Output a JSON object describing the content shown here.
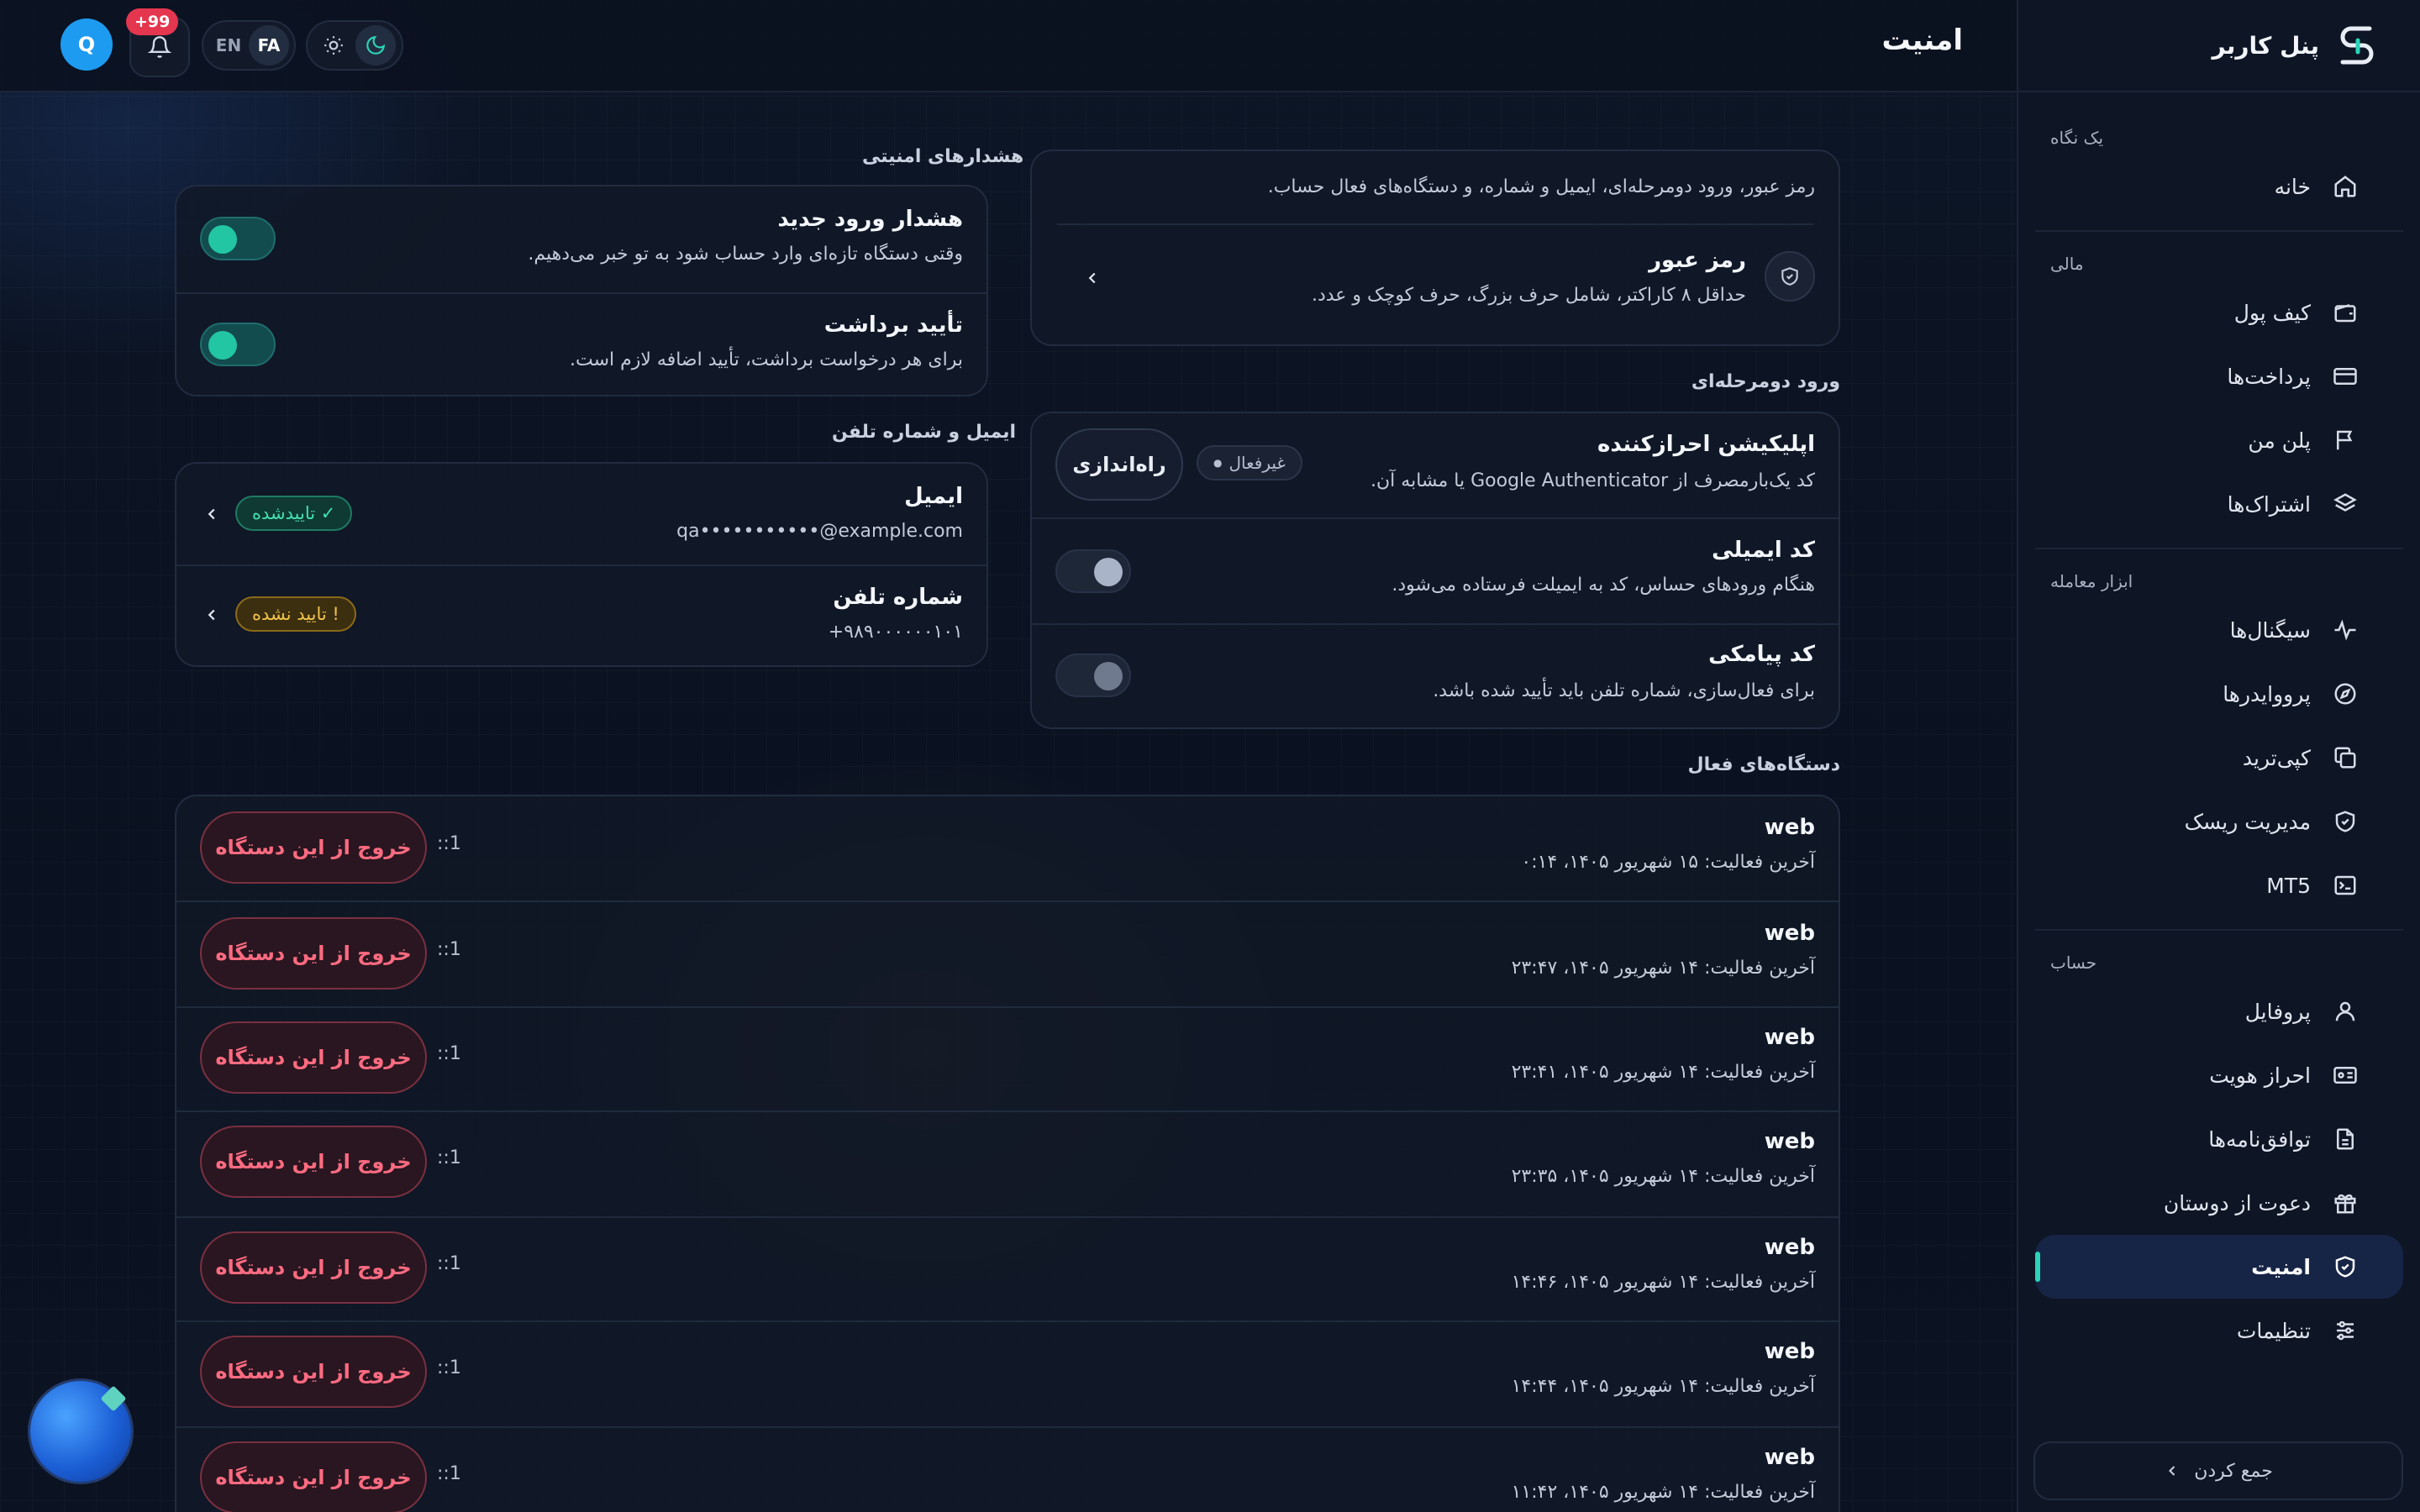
{
  "sidebar": {
    "brand": "پنل کاربر",
    "sections": [
      {
        "label": "یک نگاه",
        "items": [
          {
            "label": "خانه",
            "icon": "home-icon"
          }
        ]
      },
      {
        "label": "مالی",
        "items": [
          {
            "label": "کیف پول",
            "icon": "wallet-icon"
          },
          {
            "label": "پرداخت‌ها",
            "icon": "card-icon"
          },
          {
            "label": "پلن من",
            "icon": "flag-icon"
          },
          {
            "label": "اشتراک‌ها",
            "icon": "layers-icon"
          }
        ]
      },
      {
        "label": "ابزار معامله",
        "items": [
          {
            "label": "سیگنال‌ها",
            "icon": "pulse-icon"
          },
          {
            "label": "پرووایدرها",
            "icon": "compass-icon"
          },
          {
            "label": "کپی‌ترید",
            "icon": "copy-icon"
          },
          {
            "label": "مدیریت ریسک",
            "icon": "shield-icon"
          },
          {
            "label": "MT5",
            "icon": "terminal-icon"
          }
        ]
      },
      {
        "label": "حساب",
        "items": [
          {
            "label": "پروفایل",
            "icon": "user-icon"
          },
          {
            "label": "احراز هویت",
            "icon": "id-card-icon"
          },
          {
            "label": "توافق‌نامه‌ها",
            "icon": "document-icon"
          },
          {
            "label": "دعوت از دوستان",
            "icon": "gift-icon"
          },
          {
            "label": "امنیت",
            "icon": "shield-check-icon",
            "active": true
          },
          {
            "label": "تنظیمات",
            "icon": "sliders-icon"
          }
        ]
      }
    ],
    "collapse_label": "جمع کردن"
  },
  "header": {
    "title": "امنیت",
    "avatar_letter": "Q",
    "notif_badge": "+99",
    "lang_fa": "FA",
    "lang_en": "EN"
  },
  "password_card": {
    "intro": "رمز عبور، ورود دومرحله‌ای، ایمیل و شماره، و دستگاه‌های فعال حساب.",
    "title": "رمز عبور",
    "subtitle": "حداقل ۸ کاراکتر، شامل حرف بزرگ، حرف کوچک و عدد."
  },
  "twofa": {
    "section_title": "ورود دومرحله‌ای",
    "app": {
      "title": "اپلیکیشن احرازکننده",
      "subtitle": "کد یک‌بارمصرف از Google Authenticator یا مشابه آن.",
      "status": "غیرفعال",
      "button": "راه‌اندازی"
    },
    "email": {
      "title": "کد ایمیلی",
      "subtitle": "هنگام ورودهای حساس، کد به ایمیلت فرستاده می‌شود."
    },
    "sms": {
      "title": "کد پیامکی",
      "subtitle": "برای فعال‌سازی، شماره تلفن باید تأیید شده باشد."
    }
  },
  "alerts": {
    "section_title": "هشدارهای امنیتی",
    "new_login": {
      "title": "هشدار ورود جدید",
      "subtitle": "وقتی دستگاه تازه‌ای وارد حساب شود به تو خبر می‌دهیم."
    },
    "withdraw": {
      "title": "تأیید برداشت",
      "subtitle": "برای هر درخواست برداشت، تأیید اضافه لازم است."
    }
  },
  "contact": {
    "section_title": "ایمیل و شماره تلفن",
    "email": {
      "title": "ایمیل",
      "value": "qa•••••••••••@example.com",
      "status": "✓ تاییدشده"
    },
    "phone": {
      "title": "شماره تلفن",
      "value": "+۹۸۹۰۰۰۰۰۰۱۰۱",
      "status": "! تایید نشده"
    }
  },
  "devices": {
    "section_title": "دستگاه‌های فعال",
    "logout_label": "خروج از این دستگاه",
    "items": [
      {
        "name": "web",
        "last": "آخرین فعالیت: ۱۵ شهریور ۱۴۰۵، ۰:۱۴",
        "id": "::1"
      },
      {
        "name": "web",
        "last": "آخرین فعالیت: ۱۴ شهریور ۱۴۰۵، ۲۳:۴۷",
        "id": "::1"
      },
      {
        "name": "web",
        "last": "آخرین فعالیت: ۱۴ شهریور ۱۴۰۵، ۲۳:۴۱",
        "id": "::1"
      },
      {
        "name": "web",
        "last": "آخرین فعالیت: ۱۴ شهریور ۱۴۰۵، ۲۳:۳۵",
        "id": "::1"
      },
      {
        "name": "web",
        "last": "آخرین فعالیت: ۱۴ شهریور ۱۴۰۵، ۱۴:۴۶",
        "id": "::1"
      },
      {
        "name": "web",
        "last": "آخرین فعالیت: ۱۴ شهریور ۱۴۰۵، ۱۴:۴۴",
        "id": "::1"
      },
      {
        "name": "web",
        "last": "آخرین فعالیت: ۱۴ شهریور ۱۴۰۵، ۱۱:۴۲",
        "id": "::1"
      }
    ]
  },
  "colors": {
    "accent": "#2ad4b8",
    "danger": "#ff6b81",
    "warn": "#f2c34a",
    "bg": "#0b1220"
  }
}
